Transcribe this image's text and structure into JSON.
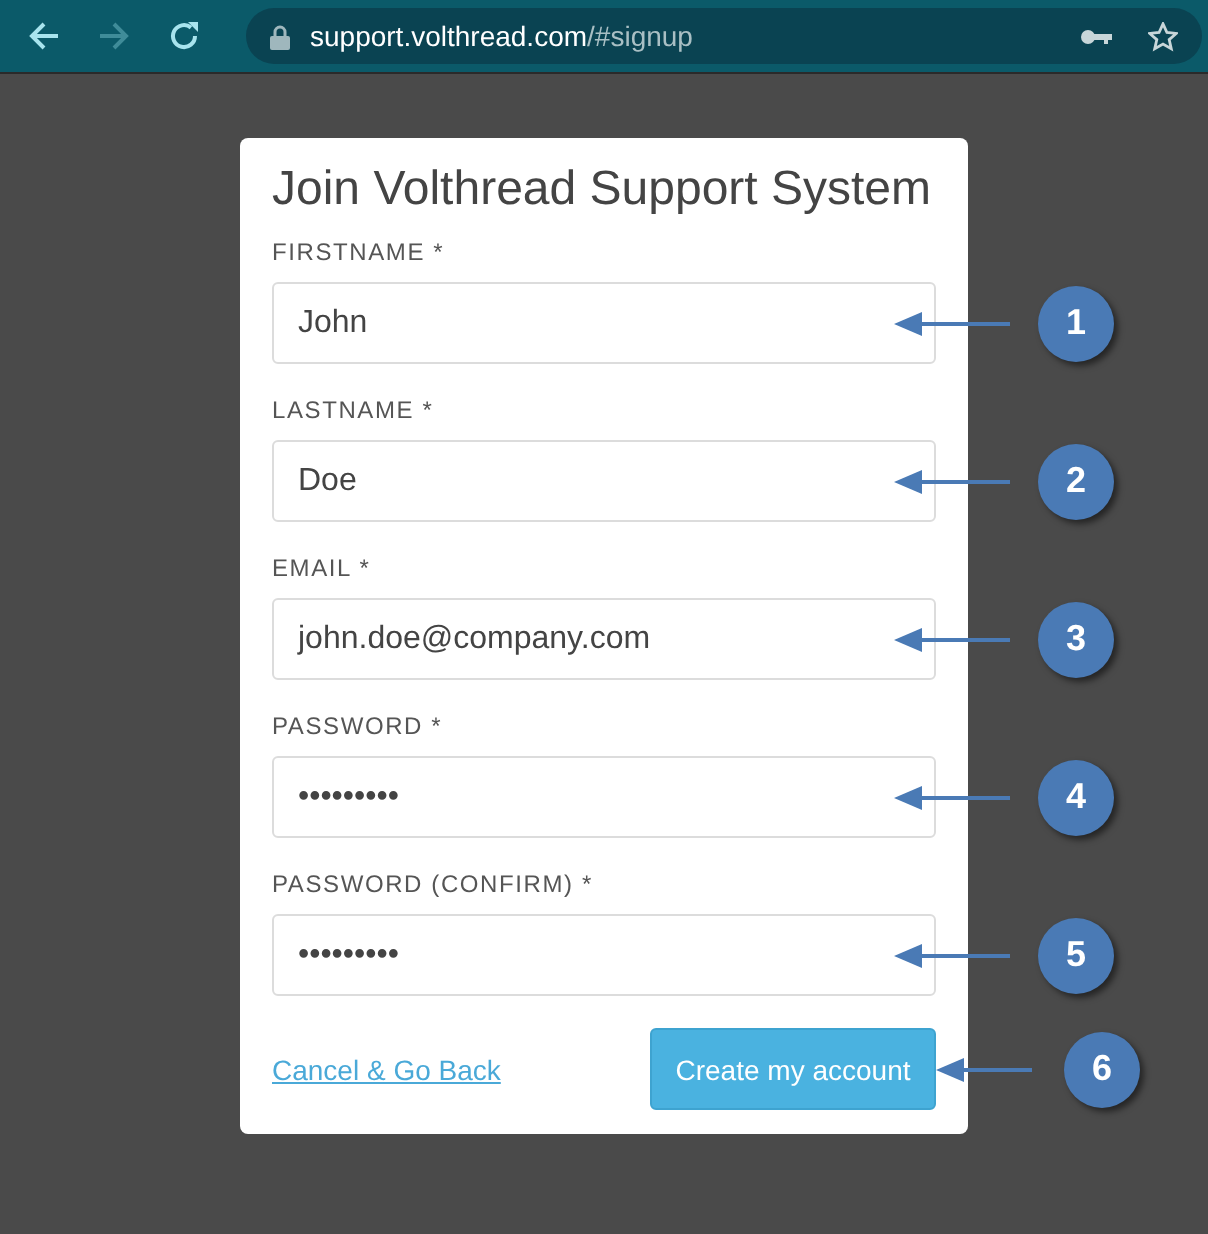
{
  "browser": {
    "url_host": "support.volthread.com",
    "url_path": "/#signup",
    "forward_disabled": true
  },
  "form": {
    "title": "Join Volthread Support System",
    "fields": [
      {
        "label": "FIRSTNAME *",
        "value": "John",
        "callout": "1"
      },
      {
        "label": "LASTNAME *",
        "value": "Doe",
        "callout": "2"
      },
      {
        "label": "EMAIL *",
        "value": "john.doe@company.com",
        "callout": "3"
      },
      {
        "label": "PASSWORD *",
        "value": "•••••••••",
        "callout": "4"
      },
      {
        "label": "PASSWORD (CONFIRM) *",
        "value": "•••••••••",
        "callout": "5"
      }
    ],
    "cancel_link": "Cancel & Go Back",
    "submit": {
      "label": "Create my account",
      "callout": "6"
    }
  }
}
